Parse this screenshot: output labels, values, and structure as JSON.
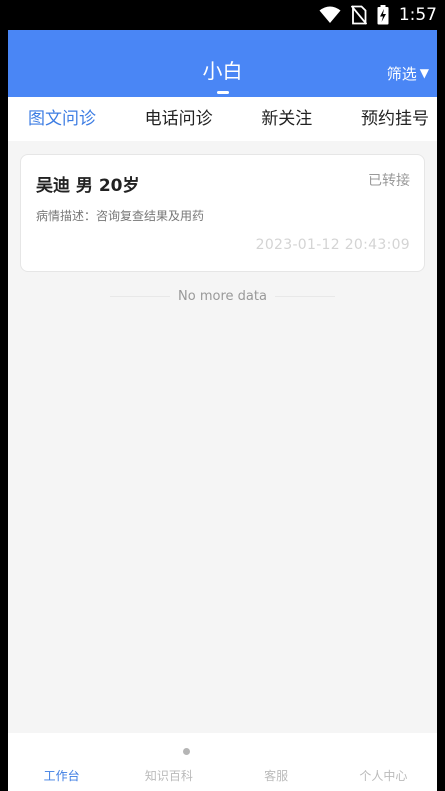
{
  "status_bar": {
    "time": "1:57",
    "icons": [
      "wifi-icon",
      "no-sim-icon",
      "battery-charging-icon"
    ]
  },
  "header": {
    "title": "小白",
    "filter_label": "筛选",
    "filter_icon": "triangle-down-icon"
  },
  "tabs": [
    {
      "label": "图文问诊",
      "active": true
    },
    {
      "label": "电话问诊",
      "active": false
    },
    {
      "label": "新关注",
      "active": false
    },
    {
      "label": "预约挂号",
      "active": false
    }
  ],
  "consultations": [
    {
      "name": "吴迪",
      "gender": "男",
      "age": "20岁",
      "status": "已转接",
      "desc_label": "病情描述：",
      "desc_value": "咨询复查结果及用药",
      "time": "2023-01-12 20:43:09"
    }
  ],
  "list_footer": "No more data",
  "bottom_nav": [
    {
      "label": "工作台",
      "active": true
    },
    {
      "label": "知识百科",
      "active": false
    },
    {
      "label": "客服",
      "active": false
    },
    {
      "label": "个人中心",
      "active": false
    }
  ],
  "colors": {
    "header_bg": "#4a86f5",
    "accent": "#3d7de3",
    "page_bg": "#f5f5f5"
  }
}
